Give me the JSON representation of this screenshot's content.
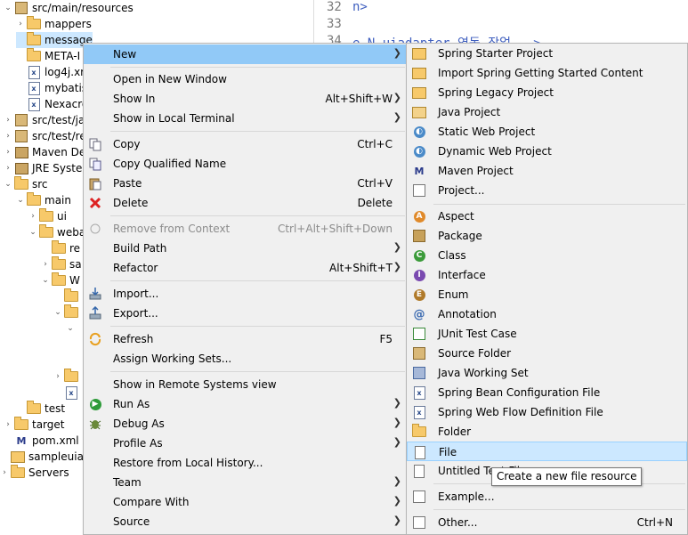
{
  "editor": {
    "lines": [
      {
        "num": "32",
        "text": "n>"
      },
      {
        "num": "33",
        "text": ""
      },
      {
        "num": "34",
        "text": "e N uiadapter 연동 작업 -->"
      }
    ]
  },
  "tree": {
    "items": [
      {
        "label": "src/main/resources",
        "icon": "source-folder-icon",
        "twisty": "expanded"
      },
      {
        "label": "mappers",
        "icon": "folder-icon",
        "twisty": "collapsed"
      },
      {
        "label": "message",
        "icon": "folder-icon",
        "twisty": "none"
      },
      {
        "label": "META-I",
        "icon": "folder-icon",
        "twisty": "none"
      },
      {
        "label": "log4j.xr",
        "icon": "xml-file-icon",
        "twisty": "none"
      },
      {
        "label": "mybatis",
        "icon": "xml-file-icon",
        "twisty": "none"
      },
      {
        "label": "Nexacro",
        "icon": "xml-file-icon",
        "twisty": "none"
      },
      {
        "label": "src/test/jav",
        "icon": "source-folder-icon",
        "twisty": "collapsed"
      },
      {
        "label": "src/test/res",
        "icon": "source-folder-icon",
        "twisty": "collapsed"
      },
      {
        "label": "Maven De",
        "icon": "library-icon",
        "twisty": "collapsed"
      },
      {
        "label": "JRE System",
        "icon": "library-icon",
        "twisty": "collapsed"
      },
      {
        "label": "src",
        "icon": "folder-icon",
        "twisty": "expanded"
      },
      {
        "label": "main",
        "icon": "folder-icon",
        "twisty": "expanded"
      },
      {
        "label": "ui",
        "icon": "folder-icon",
        "twisty": "collapsed"
      },
      {
        "label": "weba",
        "icon": "folder-icon",
        "twisty": "expanded"
      },
      {
        "label": "re",
        "icon": "folder-icon",
        "twisty": "none"
      },
      {
        "label": "sa",
        "icon": "folder-icon",
        "twisty": "collapsed"
      },
      {
        "label": "W",
        "icon": "folder-icon",
        "twisty": "expanded"
      },
      {
        "label": "",
        "icon": "folder-icon",
        "twisty": "none"
      },
      {
        "label": "",
        "icon": "folder-icon",
        "twisty": "expanded"
      },
      {
        "label": "",
        "icon": "none",
        "twisty": "expanded"
      },
      {
        "label": "",
        "icon": "none",
        "twisty": "none"
      },
      {
        "label": "",
        "icon": "folder-icon",
        "twisty": "collapsed"
      },
      {
        "label": "",
        "icon": "xml-file-icon",
        "twisty": "none"
      },
      {
        "label": "test",
        "icon": "folder-icon",
        "twisty": "none"
      },
      {
        "label": "target",
        "icon": "folder-icon",
        "twisty": "collapsed"
      },
      {
        "label": "pom.xml",
        "icon": "maven-file-icon",
        "twisty": "none"
      },
      {
        "label": "sampleuiadap",
        "icon": "project-icon",
        "twisty": "none"
      },
      {
        "label": "Servers",
        "icon": "folder-icon",
        "twisty": "collapsed"
      }
    ]
  },
  "menu": {
    "new": "New",
    "open_new_window": "Open in New Window",
    "show_in": "Show In",
    "show_in_shortcut": "Alt+Shift+W",
    "show_local_terminal": "Show in Local Terminal",
    "copy": "Copy",
    "copy_shortcut": "Ctrl+C",
    "copy_qualified": "Copy Qualified Name",
    "paste": "Paste",
    "paste_shortcut": "Ctrl+V",
    "delete": "Delete",
    "delete_shortcut": "Delete",
    "remove_context": "Remove from Context",
    "remove_context_shortcut": "Ctrl+Alt+Shift+Down",
    "build_path": "Build Path",
    "refactor": "Refactor",
    "refactor_shortcut": "Alt+Shift+T",
    "import": "Import...",
    "export": "Export...",
    "refresh": "Refresh",
    "refresh_shortcut": "F5",
    "assign_working_sets": "Assign Working Sets...",
    "show_remote": "Show in Remote Systems view",
    "run_as": "Run As",
    "debug_as": "Debug As",
    "profile_as": "Profile As",
    "restore_history": "Restore from Local History...",
    "team": "Team",
    "compare_with": "Compare With",
    "source": "Source"
  },
  "submenu": {
    "spring_starter": "Spring Starter Project",
    "import_spring_guide": "Import Spring Getting Started Content",
    "spring_legacy": "Spring Legacy Project",
    "java_project": "Java Project",
    "static_web": "Static Web Project",
    "dynamic_web": "Dynamic Web Project",
    "maven_project": "Maven Project",
    "project": "Project...",
    "aspect": "Aspect",
    "package": "Package",
    "class": "Class",
    "interface": "Interface",
    "enum": "Enum",
    "annotation": "Annotation",
    "junit": "JUnit Test Case",
    "source_folder": "Source Folder",
    "java_working_set": "Java Working Set",
    "spring_bean_config": "Spring Bean Configuration File",
    "spring_web_flow": "Spring Web Flow Definition File",
    "folder": "Folder",
    "file": "File",
    "untitled_text": "Untitled Text File",
    "example": "Example...",
    "other": "Other...",
    "other_shortcut": "Ctrl+N"
  },
  "tooltip": "Create a new file resource",
  "colors": {
    "highlight": "#91c9f7",
    "hover": "#cce8ff",
    "menu_bg": "#f0f0f0",
    "selection": "#cde8ff"
  }
}
